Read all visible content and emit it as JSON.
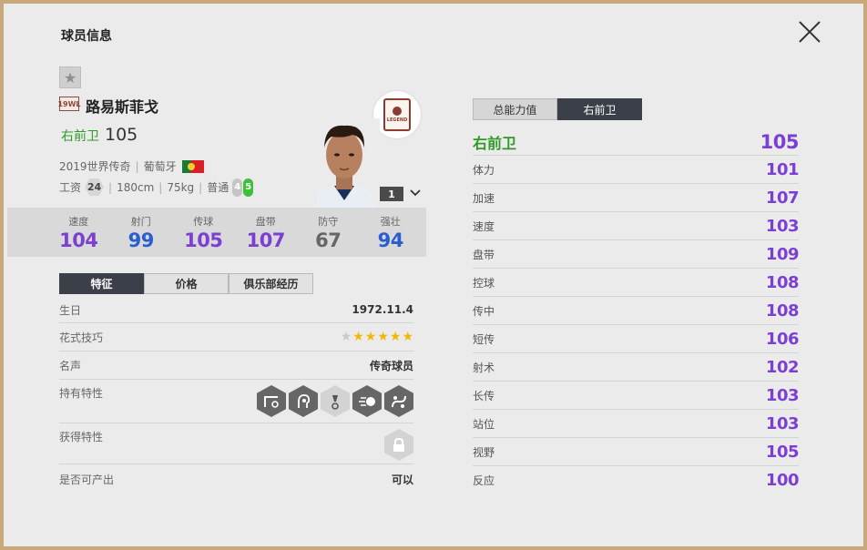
{
  "window": {
    "title": "球员信息"
  },
  "player": {
    "season_icon_text": "19WL",
    "name": "路易斯菲戈",
    "position": "右前卫",
    "position_ovr": "105",
    "season": "2019世界传奇",
    "nationality": "葡萄牙",
    "wage_label": "工资",
    "wage": "24",
    "height": "180cm",
    "weight": "75kg",
    "body_type": "普通",
    "weak_foot": "4",
    "strong_foot": "5",
    "level": "1",
    "badge_text": "LEGEND"
  },
  "summary_stats": [
    {
      "label": "速度",
      "value": "104",
      "color": "#7b3fd4"
    },
    {
      "label": "射门",
      "value": "99",
      "color": "#2a5ed0"
    },
    {
      "label": "传球",
      "value": "105",
      "color": "#7b3fd4"
    },
    {
      "label": "盘带",
      "value": "107",
      "color": "#7b3fd4"
    },
    {
      "label": "防守",
      "value": "67",
      "color": "#666666"
    },
    {
      "label": "强壮",
      "value": "94",
      "color": "#2a5ed0"
    }
  ],
  "left_tabs": [
    {
      "label": "特征",
      "active": true
    },
    {
      "label": "价格",
      "active": false
    },
    {
      "label": "俱乐部经历",
      "active": false
    }
  ],
  "info": {
    "birthday_label": "生日",
    "birthday": "1972.11.4",
    "skill_label": "花式技巧",
    "skill_stars": 5,
    "skill_stars_max": 6,
    "fame_label": "名声",
    "fame": "传奇球员",
    "traits_label": "持有特性",
    "traits": [
      "cross-trait-icon",
      "playmaker-trait-icon",
      "flair-trait-icon",
      "speed-dribbler-trait-icon",
      "technical-dribbler-trait-icon"
    ],
    "acquired_label": "获得特性",
    "produce_label": "是否可产出",
    "produce": "可以"
  },
  "right_tabs": [
    {
      "label": "总能力值",
      "active": false
    },
    {
      "label": "右前卫",
      "active": true
    }
  ],
  "attributes_header": {
    "label": "右前卫",
    "value": "105"
  },
  "attributes": [
    {
      "label": "体力",
      "value": "101"
    },
    {
      "label": "加速",
      "value": "107"
    },
    {
      "label": "速度",
      "value": "103"
    },
    {
      "label": "盘带",
      "value": "109"
    },
    {
      "label": "控球",
      "value": "108"
    },
    {
      "label": "传中",
      "value": "108"
    },
    {
      "label": "短传",
      "value": "106"
    },
    {
      "label": "射术",
      "value": "102"
    },
    {
      "label": "长传",
      "value": "103"
    },
    {
      "label": "站位",
      "value": "103"
    },
    {
      "label": "视野",
      "value": "105"
    },
    {
      "label": "反应",
      "value": "100"
    }
  ],
  "colors": {
    "accent_green": "#2f9a26",
    "stat_purple": "#7b3fd4",
    "stat_blue": "#2a5ed0",
    "tab_dark": "#3b3f48",
    "frame": "#c9a87c"
  }
}
